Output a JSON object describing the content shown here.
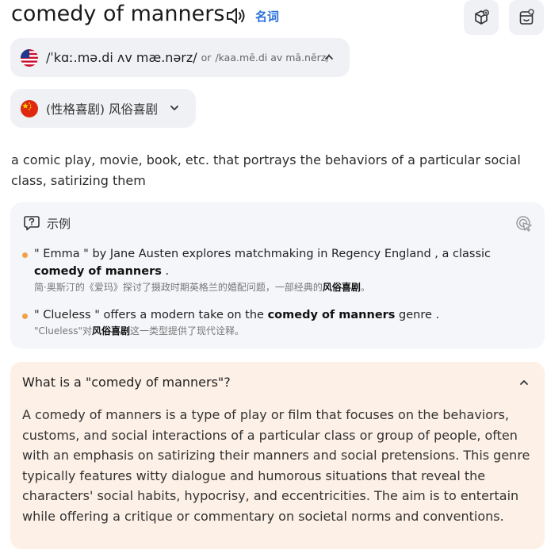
{
  "header": {
    "word": "comedy of manners",
    "part_of_speech": "名词",
    "icons": [
      "speaker-icon",
      "package-add-icon",
      "dictionary-icon"
    ]
  },
  "pronunciation_us": {
    "ipa": "/ˈkɑː.mə.di ʌv mæ.nərz/",
    "or_label": "or",
    "respelling": "/kaa.mē.di av mā.nērz/"
  },
  "translation_cn": {
    "text": "(性格喜剧) 风俗喜剧"
  },
  "definition": "a comic play, movie, book, etc. that portrays the behaviors of a particular social class, satirizing them",
  "examples": {
    "title": "示例",
    "items": [
      {
        "en_before": " \" Emma \" by Jane Austen explores matchmaking in Regency England , a classic ",
        "en_bold": "comedy of manners",
        "en_after": " .",
        "zh_before": "简·奥斯汀的《爱玛》探讨了摄政时期英格兰的婚配问题，一部经典的",
        "zh_bold": "风俗喜剧",
        "zh_after": "。"
      },
      {
        "en_before": " \" Clueless \" offers a modern take on the ",
        "en_bold": "comedy of manners",
        "en_after": " genre .",
        "zh_before": "\"Clueless\"对",
        "zh_bold": "风俗喜剧",
        "zh_after": "这一类型提供了现代诠释。"
      }
    ]
  },
  "faq": {
    "question": "What is a \"comedy of manners\"?",
    "answer": "A comedy of manners is a type of play or film that focuses on the behaviors, customs, and social interactions of a particular class or group of people, often with an emphasis on satirizing their manners and social pretensions. This genre typically features witty dialogue and humorous situations that reveal the characters' social habits, hypocrisy, and eccentricities. The aim is to entertain while offering a critique or commentary on societal norms and conventions."
  },
  "colors": {
    "accent_blue": "#2a6fdb",
    "bullet_orange": "#f2a14a",
    "faq_bg": "#fdf0e6",
    "pill_bg": "#eff1f4"
  }
}
